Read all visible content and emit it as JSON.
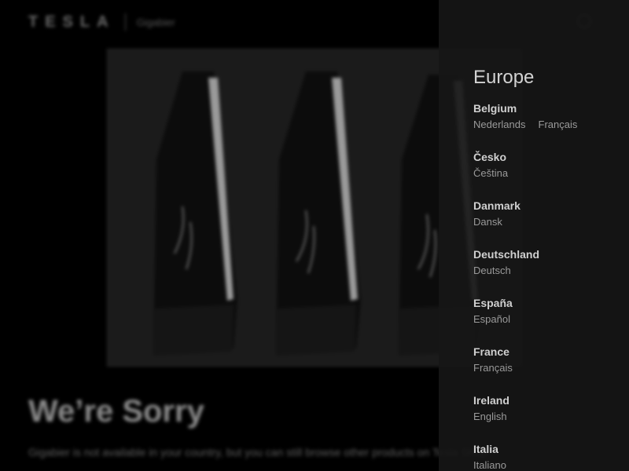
{
  "header": {
    "brand": "TESLA",
    "product": "Gigabier",
    "account_icon": "account-icon"
  },
  "hero": {
    "image": "gigabier-bottles-photo"
  },
  "notice": {
    "title": "We’re Sorry",
    "text": "Gigabier is not available in your country, but you can still browse other products on Tesla Shop."
  },
  "region": {
    "title": "Europe",
    "countries": [
      {
        "name": "Belgium",
        "languages": [
          "Nederlands",
          "Français"
        ]
      },
      {
        "name": "Česko",
        "languages": [
          "Čeština"
        ]
      },
      {
        "name": "Danmark",
        "languages": [
          "Dansk"
        ]
      },
      {
        "name": "Deutschland",
        "languages": [
          "Deutsch"
        ]
      },
      {
        "name": "España",
        "languages": [
          "Español"
        ]
      },
      {
        "name": "France",
        "languages": [
          "Français"
        ]
      },
      {
        "name": "Ireland",
        "languages": [
          "English"
        ]
      },
      {
        "name": "Italia",
        "languages": [
          "Italiano"
        ]
      }
    ]
  },
  "colors": {
    "background": "#000000",
    "panel": "#161616",
    "panel_text": "#d0d0d0",
    "language_text": "#9a9a9a"
  }
}
